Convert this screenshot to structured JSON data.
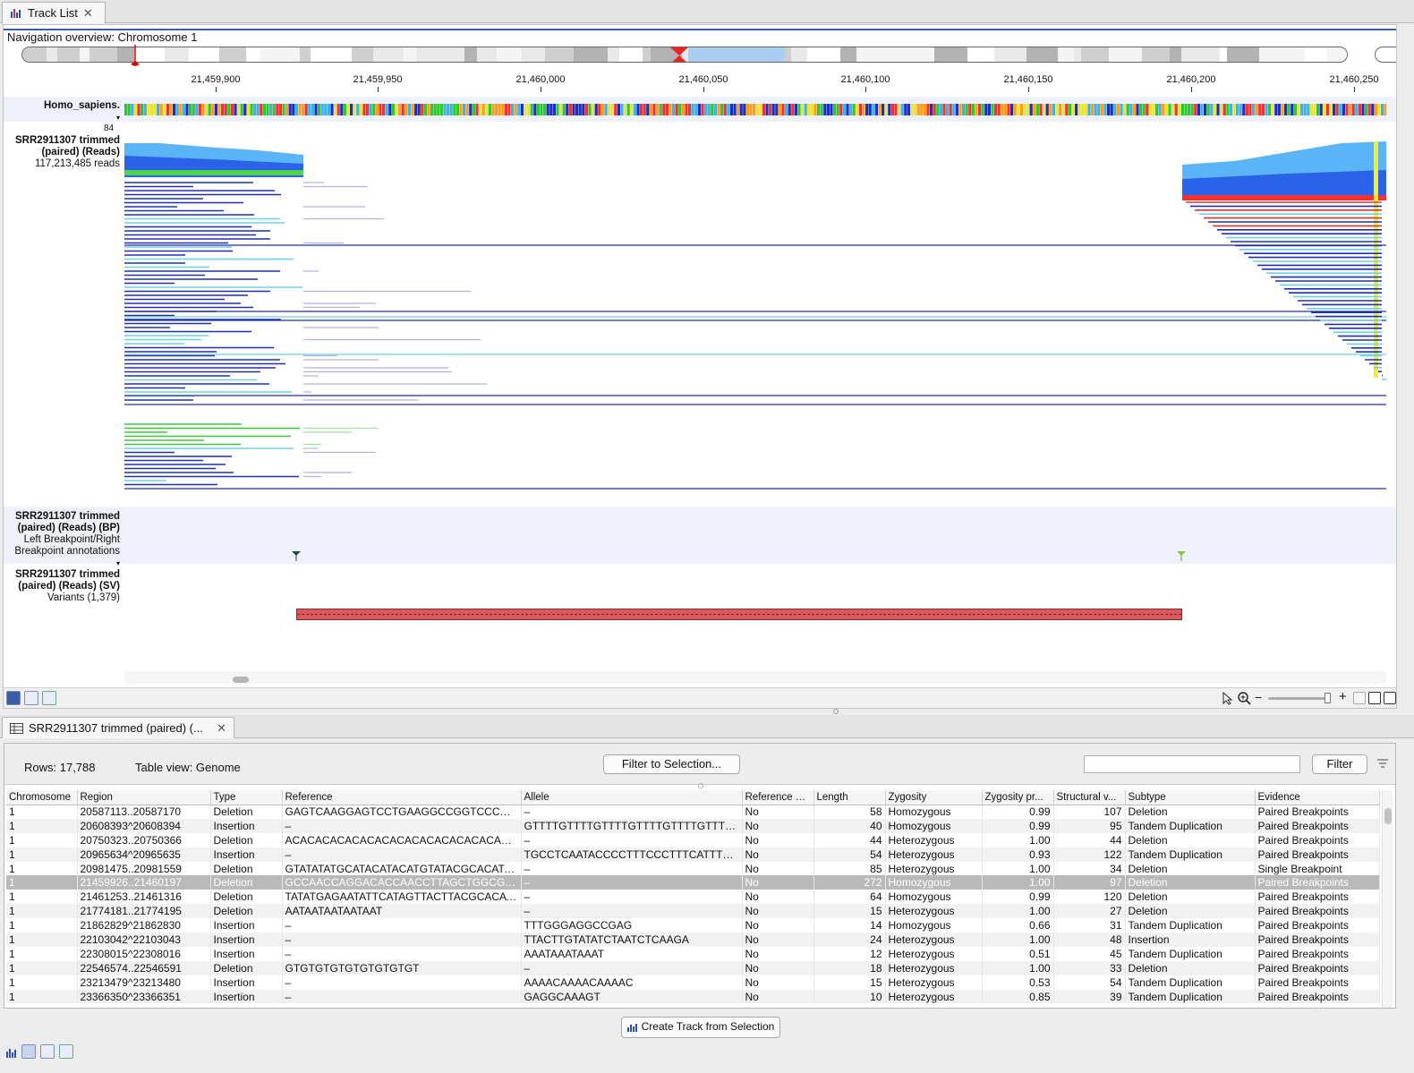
{
  "top_tab": {
    "title": "Track List",
    "close": "✕"
  },
  "navigation": {
    "title": "Navigation overview: Chromosome 1"
  },
  "ruler": {
    "ticks": [
      "21,459,900",
      "21,459,950",
      "21,460,000",
      "21,460,050",
      "21,460,100",
      "21,460,150",
      "21,460,200",
      "21,460,250"
    ]
  },
  "tracks": {
    "sequence": {
      "label": "Homo_sapiens."
    },
    "reads": {
      "max": "84",
      "line1": "SRR2911307 trimmed",
      "line2": "(paired) (Reads)",
      "line3": "117,213,485 reads"
    },
    "breakpoints": {
      "line1": "SRR2911307 trimmed",
      "line2": "(paired) (Reads) (BP)",
      "line3": "Left Breakpoint/Right",
      "line4": "Breakpoint annotations"
    },
    "variants": {
      "line1": "SRR2911307 trimmed",
      "line2": "(paired) (Reads) (SV)",
      "line3": "Variants (1,379)"
    }
  },
  "table_tab": {
    "title": "SRR2911307 trimmed (paired) (...",
    "close": "✕"
  },
  "table_toolbar": {
    "rows": "Rows: 17,788",
    "view": "Table view: Genome",
    "filter_selection": "Filter to Selection...",
    "filter": "Filter",
    "search_placeholder": ""
  },
  "table": {
    "columns": [
      "Chromosome",
      "Region",
      "Type",
      "Reference",
      "Allele",
      "Reference al...",
      "Length",
      "Zygosity",
      "Zygosity pr...",
      "Structural v...",
      "Subtype",
      "Evidence"
    ],
    "rows": [
      [
        "1",
        "20587113..20587170",
        "Deletion",
        "GAGTCAAGGAGTCCTGAAGGCCGGTCCCAGGAAGG",
        "–",
        "No",
        "58",
        "Homozygous",
        "0.99",
        "107",
        "Deletion",
        "Paired Breakpoints"
      ],
      [
        "1",
        "20608393^20608394",
        "Insertion",
        "–",
        "GTTTTGTTTTGTTTTGTTTTGTTTTGTTTTGTTTTGTTTTG",
        "No",
        "40",
        "Homozygous",
        "0.99",
        "95",
        "Tandem Duplication",
        "Paired Breakpoints"
      ],
      [
        "1",
        "20750323..20750366",
        "Deletion",
        "ACACACACACACACACACACACACACACACACACAC",
        "–",
        "No",
        "44",
        "Heterozygous",
        "1.00",
        "44",
        "Deletion",
        "Paired Breakpoints"
      ],
      [
        "1",
        "20965634^20965635",
        "Insertion",
        "–",
        "TGCCTCAATACCCCTTTCCCTTTCATTTTGCCTCAA",
        "No",
        "54",
        "Heterozygous",
        "0.93",
        "122",
        "Tandem Duplication",
        "Paired Breakpoints"
      ],
      [
        "1",
        "20981475..20981559",
        "Deletion",
        "GTATATATGCATACATACATGTATACGCACATACAT",
        "–",
        "No",
        "85",
        "Heterozygous",
        "1.00",
        "34",
        "Deletion",
        "Single Breakpoint"
      ],
      [
        "1",
        "21459926..21460197",
        "Deletion",
        "GCCAACCAGGACACCAACCTTAGCTGGCGTCCAAC",
        "–",
        "No",
        "272",
        "Homozygous",
        "1.00",
        "97",
        "Deletion",
        "Paired Breakpoints"
      ],
      [
        "1",
        "21461253..21461316",
        "Deletion",
        "TATATGAGAATATTCATAGTTACTTACGCACATTAT",
        "–",
        "No",
        "64",
        "Homozygous",
        "0.99",
        "120",
        "Deletion",
        "Paired Breakpoints"
      ],
      [
        "1",
        "21774181..21774195",
        "Deletion",
        "AATAATAATAATAAT",
        "–",
        "No",
        "15",
        "Heterozygous",
        "1.00",
        "27",
        "Deletion",
        "Paired Breakpoints"
      ],
      [
        "1",
        "21862829^21862830",
        "Insertion",
        "–",
        "TTTGGGAGGCCGAG",
        "No",
        "14",
        "Homozygous",
        "0.66",
        "31",
        "Tandem Duplication",
        "Paired Breakpoints"
      ],
      [
        "1",
        "22103042^22103043",
        "Insertion",
        "–",
        "TTACTTGTATATCTAATCTCAAGA",
        "No",
        "24",
        "Heterozygous",
        "1.00",
        "48",
        "Insertion",
        "Paired Breakpoints"
      ],
      [
        "1",
        "22308015^22308016",
        "Insertion",
        "–",
        "AAATAAATAAAT",
        "No",
        "12",
        "Heterozygous",
        "0.51",
        "45",
        "Tandem Duplication",
        "Paired Breakpoints"
      ],
      [
        "1",
        "22546574..22546591",
        "Deletion",
        "GTGTGTGTGTGTGTGTGT",
        "–",
        "No",
        "18",
        "Heterozygous",
        "1.00",
        "33",
        "Deletion",
        "Paired Breakpoints"
      ],
      [
        "1",
        "23213479^23213480",
        "Insertion",
        "–",
        "AAAACAAAACAAAAC",
        "No",
        "15",
        "Heterozygous",
        "0.53",
        "54",
        "Tandem Duplication",
        "Paired Breakpoints"
      ],
      [
        "1",
        "23366350^23366351",
        "Insertion",
        "–",
        "GAGGCAAAGT",
        "No",
        "10",
        "Heterozygous",
        "0.85",
        "39",
        "Tandem Duplication",
        "Paired Breakpoints"
      ]
    ],
    "selected_row": 5
  },
  "create_button": "Create Track from Selection",
  "colors": {
    "accent": "#3b5ea8",
    "variant_bar": "#d9595e",
    "read_blue": "#1f2fb0",
    "read_green": "#3fc43f",
    "read_light": "#5ad0e6"
  }
}
